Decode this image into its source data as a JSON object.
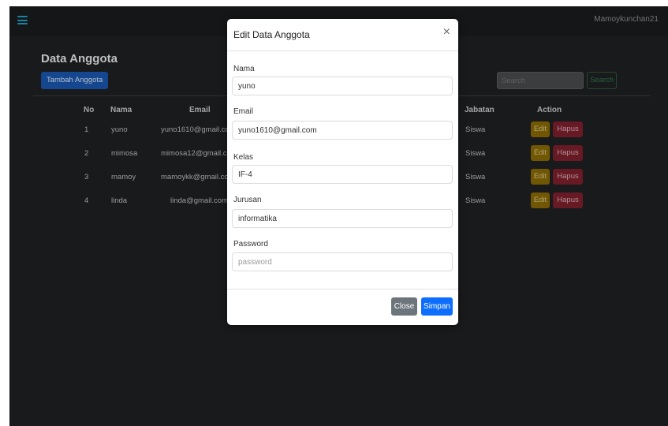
{
  "navbar": {
    "username": "Mamoykunchan21"
  },
  "page": {
    "title": "Data Anggota",
    "add_button": "Tambah Anggota",
    "search_placeholder": "Search",
    "search_button": "Search"
  },
  "table": {
    "headers": {
      "no": "No",
      "nama": "Nama",
      "email": "Email",
      "jabatan": "Jabatan",
      "action": "Action"
    },
    "rows": [
      {
        "no": "1",
        "nama": "yuno",
        "email": "yuno1610@gmail.com",
        "jabatan": "Siswa"
      },
      {
        "no": "2",
        "nama": "mimosa",
        "email": "mimosa12@gmail.com",
        "jabatan": "Siswa"
      },
      {
        "no": "3",
        "nama": "mamoy",
        "email": "mamoykk@gmail.com",
        "jabatan": "Siswa"
      },
      {
        "no": "4",
        "nama": "linda",
        "email": "linda@gmail.com",
        "jabatan": "Siswa"
      }
    ],
    "edit_label": "Edit",
    "delete_label": "Hapus"
  },
  "modal": {
    "title": "Edit Data Anggota",
    "close_icon": "×",
    "fields": {
      "nama": {
        "label": "Nama",
        "value": "yuno"
      },
      "email": {
        "label": "Email",
        "value": "yuno1610@gmail.com"
      },
      "kelas": {
        "label": "Kelas",
        "value": "IF-4"
      },
      "jurusan": {
        "label": "Jurusan",
        "value": "informatika"
      },
      "password": {
        "label": "Password",
        "value": "",
        "placeholder": "password"
      }
    },
    "close_button": "Close",
    "save_button": "Simpan"
  },
  "colors": {
    "primary": "#0d6efd",
    "secondary": "#6d757c",
    "edit": "#8a6b06",
    "delete": "#7e1f2c",
    "navbar_icon": "#1aa3c8"
  },
  "icons": {
    "menu": "hamburger-icon",
    "close": "close-icon"
  }
}
